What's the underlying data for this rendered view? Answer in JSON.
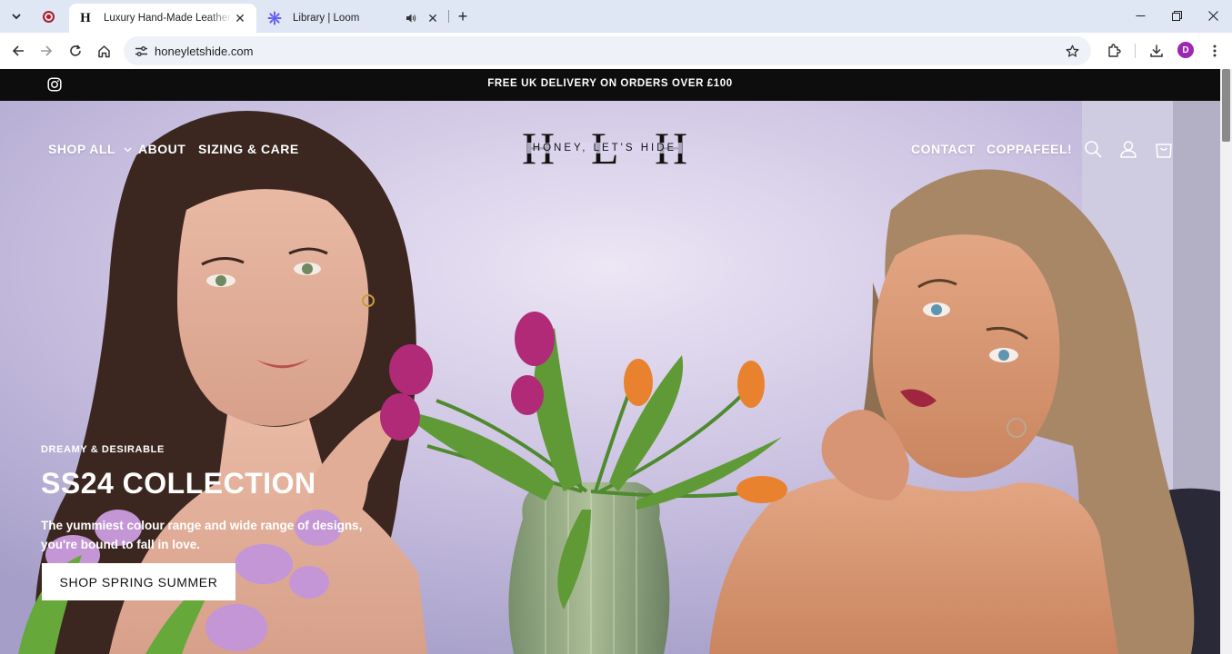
{
  "browser": {
    "tabs": [
      {
        "title": "Luxury Hand-Made Leather Acc",
        "active": true
      },
      {
        "title": "Library | Loom",
        "active": false
      }
    ],
    "url": "honeyletshide.com",
    "profile_initial": "D"
  },
  "page": {
    "announcement": "FREE UK DELIVERY ON ORDERS OVER £100",
    "nav_left": [
      "SHOP ALL",
      "ABOUT",
      "SIZING & CARE"
    ],
    "nav_right": [
      "CONTACT",
      "COPPAFEEL!"
    ],
    "logo": {
      "initials": [
        "H",
        "L",
        "H"
      ],
      "text": "HONEY, LET'S HIDE"
    },
    "hero": {
      "subheading": "DREAMY & DESIRABLE",
      "title": "SS24 COLLECTION",
      "description_lines": [
        "The yummiest colour range and wide range of designs,",
        "you're bound to fall in love."
      ],
      "cta": "SHOP SPRING SUMMER"
    }
  },
  "icons": [
    "instagram-icon",
    "search-icon",
    "account-icon",
    "cart-icon",
    "chevron-down-icon"
  ],
  "colors": {
    "announcement_bg": "#0d0d0d",
    "brand_text": "#111111",
    "tab_strip": "#dfe6f4",
    "profile": "#9c27b0"
  }
}
